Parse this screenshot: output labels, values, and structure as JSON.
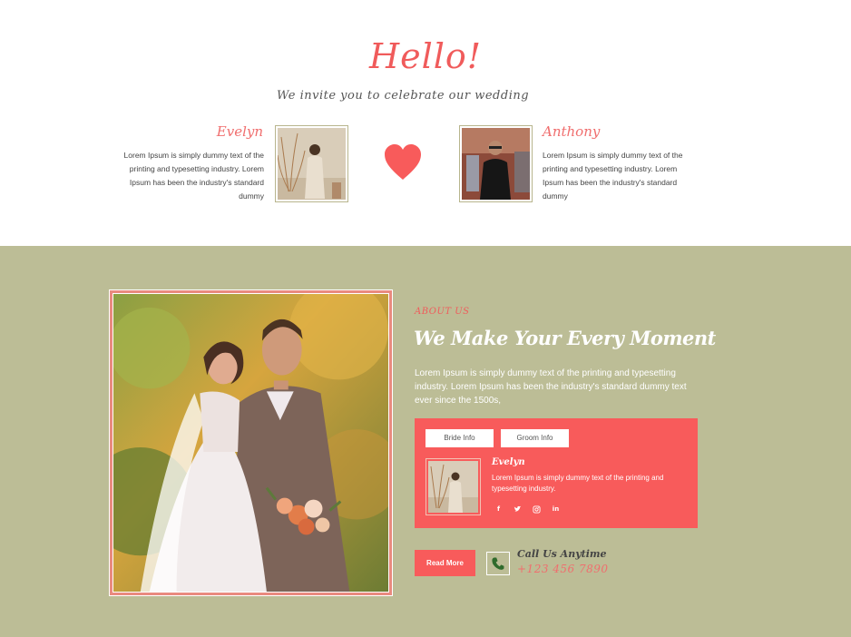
{
  "intro": {
    "heading": "Hello!",
    "subheading": "We invite you to celebrate our wedding"
  },
  "bride": {
    "name": "Evelyn",
    "text": "Lorem Ipsum is simply dummy text of the printing and typesetting industry. Lorem Ipsum has been the industry's standard dummy"
  },
  "groom": {
    "name": "Anthony",
    "text": "Lorem Ipsum is simply dummy text of the printing and typesetting industry. Lorem Ipsum has been the industry's standard dummy"
  },
  "about": {
    "kicker": "ABOUT US",
    "title": "We Make Your Every Moment",
    "text": "Lorem Ipsum is simply dummy text of the printing and typesetting industry. Lorem Ipsum has been the industry's standard dummy text ever since the 1500s,"
  },
  "info_box": {
    "tabs": [
      "Bride Info",
      "Groom Info"
    ],
    "name": "Evelyn",
    "text": "Lorem Ipsum is simply dummy text of the printing and typesetting industry.",
    "socials": [
      "f",
      "t",
      "ig",
      "in"
    ]
  },
  "cta": {
    "read_more": "Read More",
    "call_label": "Call Us Anytime",
    "phone": "+123 456 7890"
  },
  "colors": {
    "accent": "#f85b5b",
    "section_bg": "#bcbd96"
  }
}
